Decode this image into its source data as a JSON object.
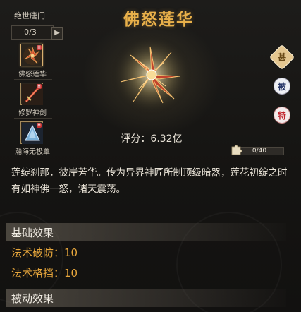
{
  "sidebar": {
    "title": "绝世唐门",
    "counter": "0/3",
    "items": [
      {
        "label": "佛怒莲华",
        "icon": "lotus-icon",
        "badge": "H",
        "selected": true
      },
      {
        "label": "修罗神剑",
        "icon": "sword-icon",
        "badge": "H",
        "selected": false
      },
      {
        "label": "瀚海无极罩",
        "icon": "shield-cone-icon",
        "badge": "H",
        "selected": false
      }
    ],
    "collapse_icon": "chevron-right-icon"
  },
  "item": {
    "title": "佛怒莲华",
    "score": "评分：6.32亿",
    "description": "莲绽刹那，彼岸芳华。传为异界神匠所制顶级暗器，莲花初绽之时有如神佛一怒，诸天震荡。"
  },
  "tags": {
    "special": "甚",
    "passive": "被",
    "exclusive": "特"
  },
  "progress": {
    "text": "0/40",
    "value": 0,
    "max": 40,
    "icon": "puzzle-icon"
  },
  "sections": {
    "basic_title": "基础效果",
    "passive_title": "被动效果"
  },
  "stats": [
    {
      "text": "法术破防：10"
    },
    {
      "text": "法术格挡：10"
    }
  ],
  "colors": {
    "title": "#e8b04a",
    "stat": "#e8a73c",
    "background": "#171614"
  }
}
